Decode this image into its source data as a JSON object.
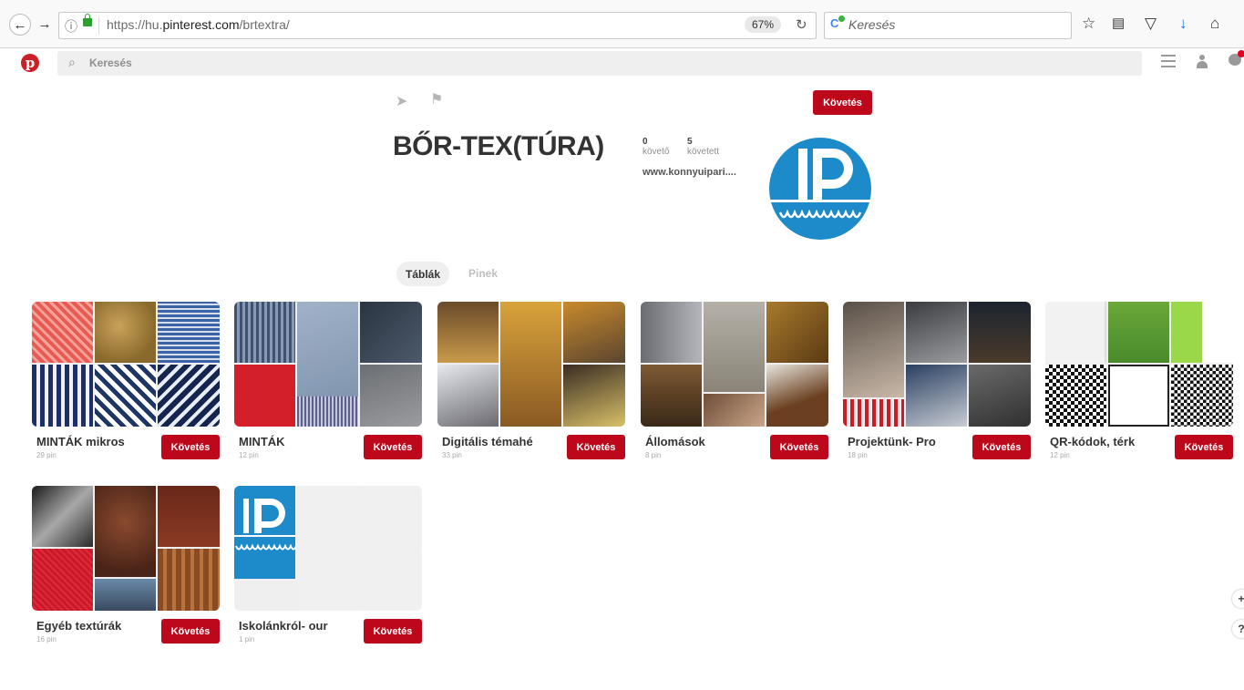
{
  "browser": {
    "url_prefix": "https://hu.",
    "url_domain": "pinterest.com",
    "url_path": "/brtextra/",
    "zoom": "67%",
    "search_placeholder": "Keresés",
    "icons": [
      "back-arrow-icon",
      "forward-arrow-icon",
      "info-icon",
      "lock-icon",
      "reload-icon",
      "bookmark-star-icon",
      "reading-list-icon",
      "pocket-icon",
      "download-icon",
      "home-icon"
    ]
  },
  "pinterest": {
    "logo": "p",
    "search_placeholder": "Keresés"
  },
  "profile": {
    "name": "BŐR-TEX(TÚRA)",
    "followers_count": "0",
    "followers_label": "követő",
    "following_count": "5",
    "following_label": "követett",
    "website": "www.konnyuipari....",
    "follow_label": "Követés"
  },
  "tabs": {
    "boards": "Táblák",
    "pins": "Pinek"
  },
  "boards": [
    {
      "title": "MINTÁK mikros",
      "count": "29 pin",
      "follow": "Követés"
    },
    {
      "title": "MINTÁK",
      "count": "12 pin",
      "follow": "Követés"
    },
    {
      "title": "Digitális témahé",
      "count": "33 pin",
      "follow": "Követés"
    },
    {
      "title": "Állomások",
      "count": "8 pin",
      "follow": "Követés"
    },
    {
      "title": "Projektünk- Pro",
      "count": "18 pin",
      "follow": "Követés"
    },
    {
      "title": "QR-kódok, térk",
      "count": "12 pin",
      "follow": "Követés"
    },
    {
      "title": "Egyéb textúrák",
      "count": "16 pin",
      "follow": "Követés"
    },
    {
      "title": "Iskolánkról- our",
      "count": "1 pin",
      "follow": "Követés"
    }
  ],
  "floating": {
    "plus": "+",
    "help": "?"
  },
  "colors": {
    "pinterest_red": "#bd081c",
    "brand_blue": "#1d8ac9"
  }
}
